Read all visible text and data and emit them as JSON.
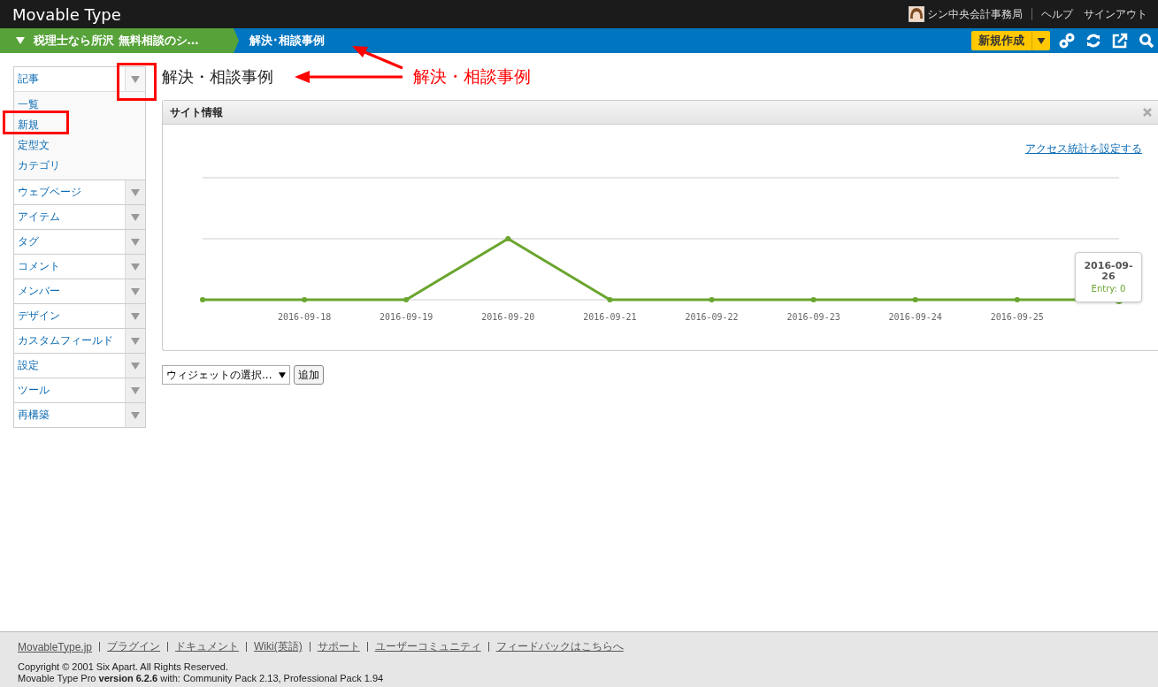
{
  "header": {
    "logo": "Movable Type",
    "user": "シン中央会計事務局",
    "links": [
      "ヘルプ",
      "サインアウト"
    ]
  },
  "breadcrumb": {
    "site": "税理士なら所沢 無料相談のシ…",
    "current": "解決･相談事例"
  },
  "new_button": {
    "label": "新規作成"
  },
  "sidebar": {
    "items": [
      {
        "label": "記事",
        "expanded": true,
        "children": [
          {
            "label": "一覧"
          },
          {
            "label": "新規"
          },
          {
            "label": "定型文"
          },
          {
            "label": "カテゴリ"
          }
        ]
      },
      {
        "label": "ウェブページ",
        "expanded": false
      },
      {
        "label": "アイテム",
        "expanded": false
      },
      {
        "label": "タグ",
        "expanded": false
      },
      {
        "label": "コメント",
        "expanded": false
      },
      {
        "label": "メンバー",
        "expanded": false
      },
      {
        "label": "デザイン",
        "expanded": false
      },
      {
        "label": "カスタムフィールド",
        "expanded": false
      },
      {
        "label": "設定",
        "expanded": false
      },
      {
        "label": "ツール",
        "expanded": false
      },
      {
        "label": "再構築",
        "expanded": false
      }
    ]
  },
  "page_title": "解決・相談事例",
  "widget": {
    "title": "サイト情報",
    "link": "アクセス統計を設定する",
    "x_labels": [
      "2016-09-18",
      "2016-09-19",
      "2016-09-20",
      "2016-09-21",
      "2016-09-22",
      "2016-09-23",
      "2016-09-24",
      "2016-09-25"
    ],
    "tooltip": {
      "date": "2016-09-26",
      "value": "Entry: 0"
    }
  },
  "widget_select": {
    "value": "ウィジェットの選択..."
  },
  "add_button": {
    "label": "追加"
  },
  "footer": {
    "links": [
      "MovableType.jp",
      "プラグイン",
      "ドキュメント",
      "Wiki(英語)",
      "サポート",
      "ユーザーコミュニティ",
      "フィードバックはこちらへ"
    ],
    "copyright": "Copyright © 2001 Six Apart. All Rights Reserved.",
    "version": "Movable Type Pro **version 6.2.6** with: Community Pack 2.13, Professional Pack 1.94"
  },
  "annotation": {
    "label": "解決・相談事例"
  }
}
